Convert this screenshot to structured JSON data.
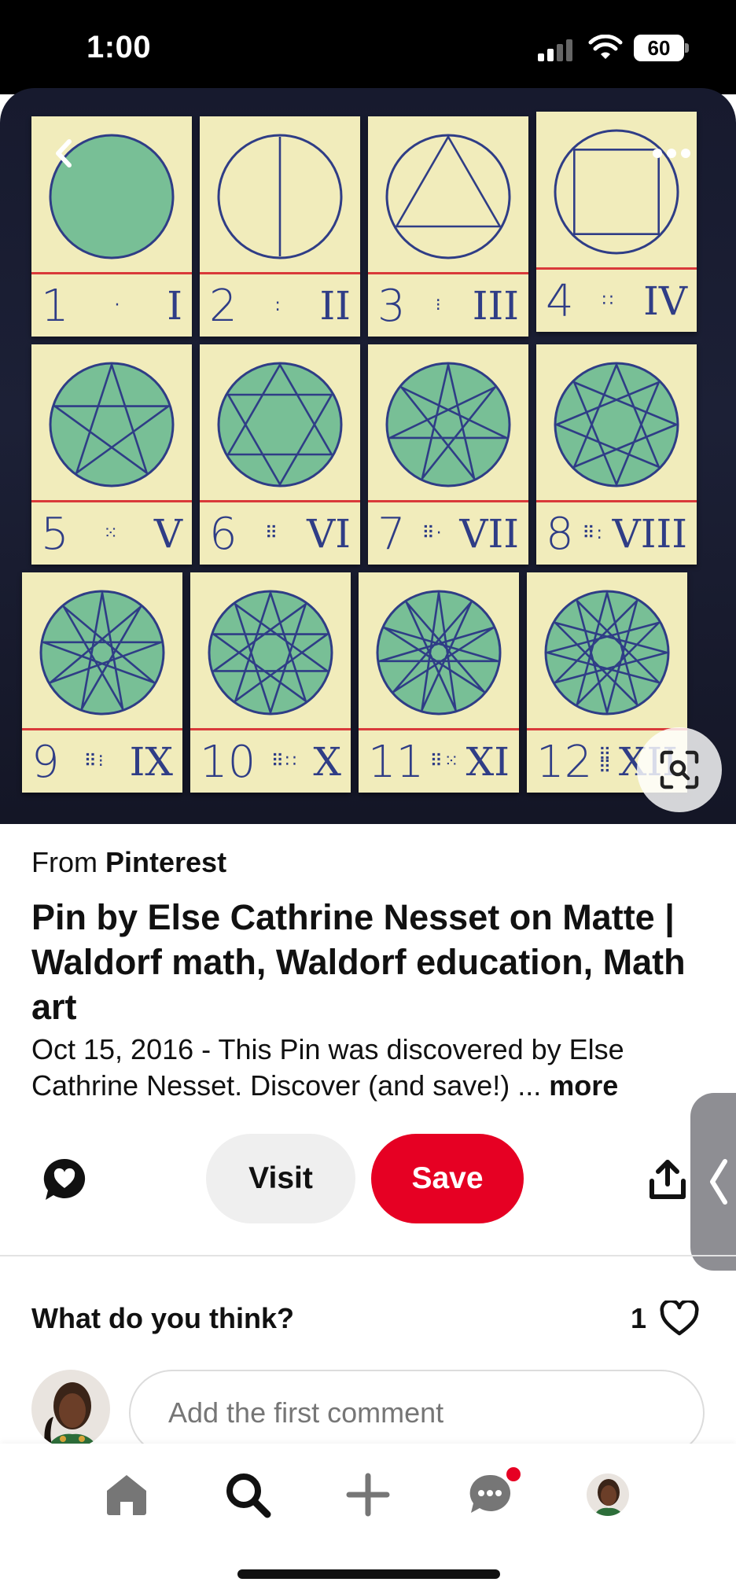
{
  "status_bar": {
    "time": "1:00",
    "battery": "60"
  },
  "pin_image": {
    "cards": [
      {
        "arabic": "1",
        "dots": "·",
        "roman": "I"
      },
      {
        "arabic": "2",
        "dots": ":",
        "roman": "II"
      },
      {
        "arabic": "3",
        "dots": "⁝",
        "roman": "III"
      },
      {
        "arabic": "4",
        "dots": "∷",
        "roman": "IV"
      },
      {
        "arabic": "5",
        "dots": "⁙",
        "roman": "V"
      },
      {
        "arabic": "6",
        "dots": "⠿",
        "roman": "VI"
      },
      {
        "arabic": "7",
        "dots": "⠿·",
        "roman": "VII"
      },
      {
        "arabic": "8",
        "dots": "⠿:",
        "roman": "VIII"
      },
      {
        "arabic": "9",
        "dots": "⠿⁝",
        "roman": "IX"
      },
      {
        "arabic": "10",
        "dots": "⠿∷",
        "roman": "X"
      },
      {
        "arabic": "11",
        "dots": "⠿⁙",
        "roman": "XI"
      },
      {
        "arabic": "12",
        "dots": "⠿⠿",
        "roman": "XII"
      }
    ]
  },
  "details": {
    "source_prefix": "From",
    "source_name": "Pinterest",
    "title": "Pin by Else Cathrine Nesset on Matte | Waldorf math, Waldorf education, Math art",
    "description": "Oct 15, 2016 - This Pin was discovered by Else Cathrine Nesset. Discover (and save!) ...",
    "more_label": "more"
  },
  "actions": {
    "visit_label": "Visit",
    "save_label": "Save"
  },
  "comments": {
    "heading": "What do you think?",
    "like_count": "1",
    "input_placeholder": "Add the first comment"
  },
  "icons": {
    "back": "chevron-left-icon",
    "more": "ellipsis-icon",
    "lens": "visual-search-icon",
    "comment": "speech-bubble-heart-icon",
    "share": "share-icon",
    "like": "heart-icon",
    "nav": [
      "home-icon",
      "search-icon",
      "plus-icon",
      "messages-icon",
      "profile-avatar"
    ]
  },
  "colors": {
    "save": "#e60023",
    "ink": "#2f3d86",
    "crayon": "#4fb08a",
    "notification": "#e60023"
  }
}
